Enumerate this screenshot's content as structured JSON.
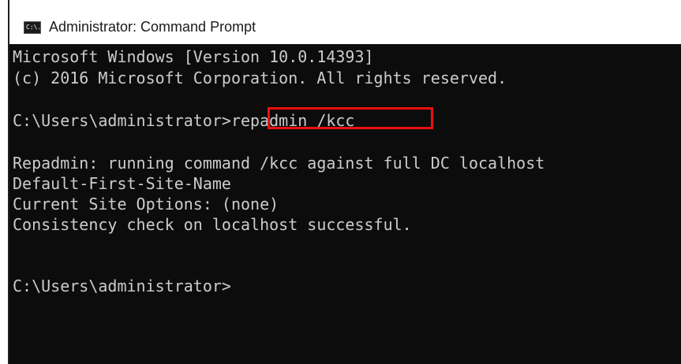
{
  "window": {
    "title": "Administrator: Command Prompt",
    "icon": "console-app-icon",
    "icon_label": "C:\\."
  },
  "console": {
    "lines": [
      "Microsoft Windows [Version 10.0.14393]",
      "(c) 2016 Microsoft Corporation. All rights reserved.",
      "",
      "C:\\Users\\administrator>repadmin /kcc",
      "",
      "Repadmin: running command /kcc against full DC localhost",
      "Default-First-Site-Name",
      "Current Site Options: (none)",
      "Consistency check on localhost successful.",
      "",
      "",
      "C:\\Users\\administrator>"
    ],
    "prompt": "C:\\Users\\administrator>",
    "highlighted_command": "repadmin /kcc",
    "highlight_color": "#e8110f",
    "background_color": "#0c0c0c",
    "text_color": "#cccccc"
  }
}
